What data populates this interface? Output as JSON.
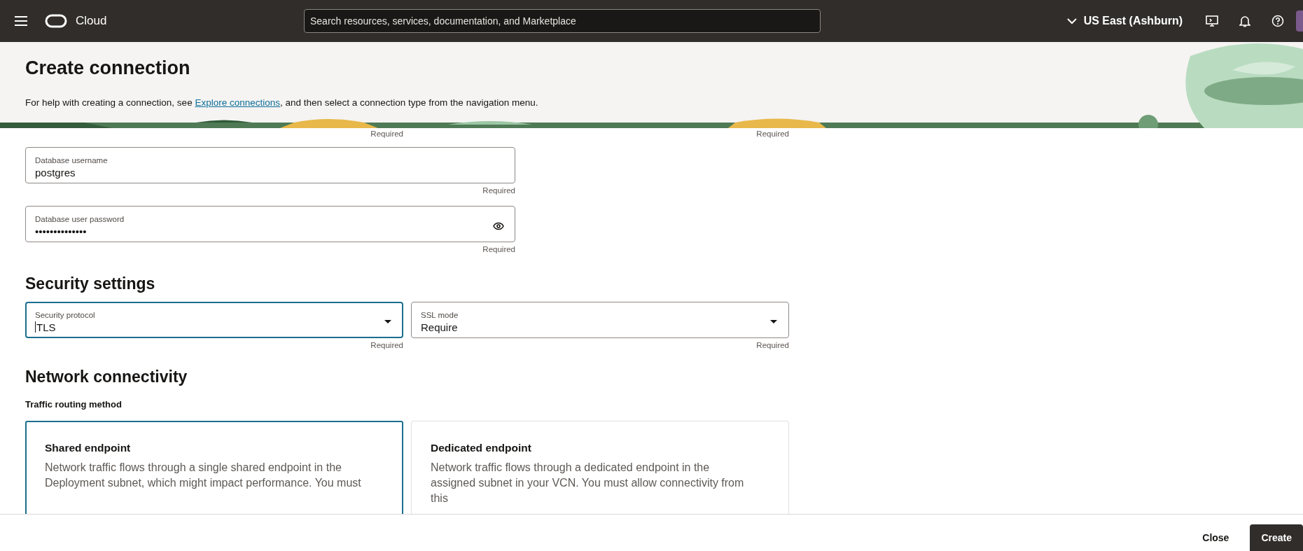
{
  "top_bar": {
    "product": "Cloud",
    "search": {
      "placeholder": "Search resources, services, documentation, and Marketplace"
    },
    "region": "US East (Ashburn)"
  },
  "header": {
    "title": "Create connection",
    "help_before": "For help with creating a connection, see ",
    "help_link": "Explore connections",
    "help_after": ", and then select a connection type from the navigation menu."
  },
  "leading_hints": [
    "Required",
    "Required"
  ],
  "credentials": [
    {
      "label": "Database username",
      "value": "postgres",
      "kind": "text",
      "hint": "Required"
    },
    {
      "label": "Database user password",
      "value": "••••••••••••••",
      "kind": "password",
      "hint": "Required"
    }
  ],
  "security": {
    "title": "Security settings",
    "fields": [
      {
        "label": "Security protocol",
        "value": "TLS",
        "focused": true,
        "hint": "Required"
      },
      {
        "label": "SSL mode",
        "value": "Require",
        "focused": false,
        "hint": "Required"
      }
    ]
  },
  "network": {
    "title": "Network connectivity",
    "group_label": "Traffic routing method",
    "options": [
      {
        "title": "Shared endpoint",
        "description": "Network traffic flows through a single shared endpoint in the Deployment subnet, which might impact performance. You must",
        "selected": true
      },
      {
        "title": "Dedicated endpoint",
        "description": "Network traffic flows through a dedicated endpoint in the assigned subnet in your VCN. You must allow connectivity from this",
        "selected": false
      }
    ]
  },
  "footer": {
    "buttons": [
      {
        "label": "Close",
        "kind": "secondary"
      },
      {
        "label": "Create",
        "kind": "primary"
      }
    ]
  }
}
